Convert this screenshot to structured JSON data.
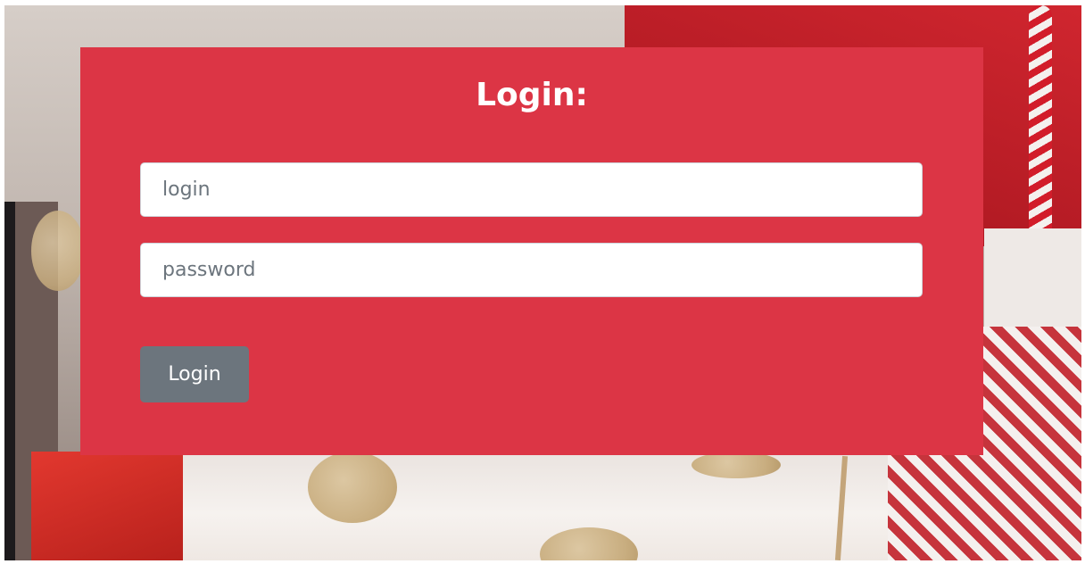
{
  "form": {
    "title": "Login:",
    "login_field": {
      "value": "",
      "placeholder": "login"
    },
    "password_field": {
      "value": "",
      "placeholder": "password"
    },
    "submit_label": "Login"
  },
  "colors": {
    "panel": "#dc3545",
    "button": "#6c757d",
    "title_text": "#ffffff"
  },
  "background": {
    "description_icon": "gift-bags-photo"
  }
}
